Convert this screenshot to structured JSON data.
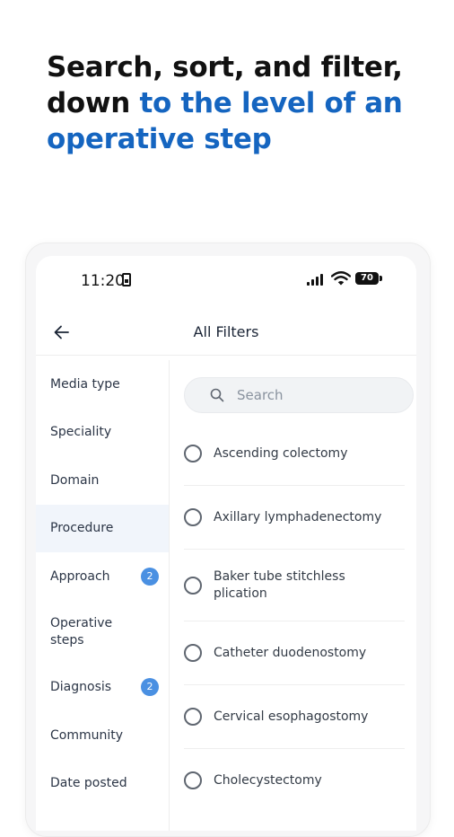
{
  "headline": {
    "line1": "Search, sort, and filter,",
    "line2_plain": "down ",
    "line2_accent": "to the level of an",
    "line3_accent": "operative step",
    "accent_color": "#1565c0"
  },
  "status_bar": {
    "time": "11:20",
    "battery": "70"
  },
  "app_bar": {
    "title": "All Filters",
    "back_icon": "arrow-left-icon"
  },
  "sidebar": {
    "items": [
      {
        "label": "Media type",
        "badge": null,
        "active": false
      },
      {
        "label": "Speciality",
        "badge": null,
        "active": false
      },
      {
        "label": "Domain",
        "badge": null,
        "active": false
      },
      {
        "label": "Procedure",
        "badge": null,
        "active": true
      },
      {
        "label": "Approach",
        "badge": "2",
        "active": false
      },
      {
        "label": "Operative steps",
        "badge": null,
        "active": false
      },
      {
        "label": "Diagnosis",
        "badge": "2",
        "active": false
      },
      {
        "label": "Community",
        "badge": null,
        "active": false
      },
      {
        "label": "Date posted",
        "badge": null,
        "active": false
      }
    ]
  },
  "search": {
    "placeholder": "Search"
  },
  "options": [
    {
      "label": "Ascending colectomy",
      "checked": false
    },
    {
      "label": "Axillary lymphadenectomy",
      "checked": false
    },
    {
      "label": "Baker tube stitchless plication",
      "checked": false
    },
    {
      "label": "Catheter duodenostomy",
      "checked": false
    },
    {
      "label": "Cervical esophagostomy",
      "checked": false
    },
    {
      "label": "Cholecystectomy",
      "checked": false
    }
  ],
  "colors": {
    "badge": "#4a90e2",
    "active_row": "#f1f5fb"
  }
}
